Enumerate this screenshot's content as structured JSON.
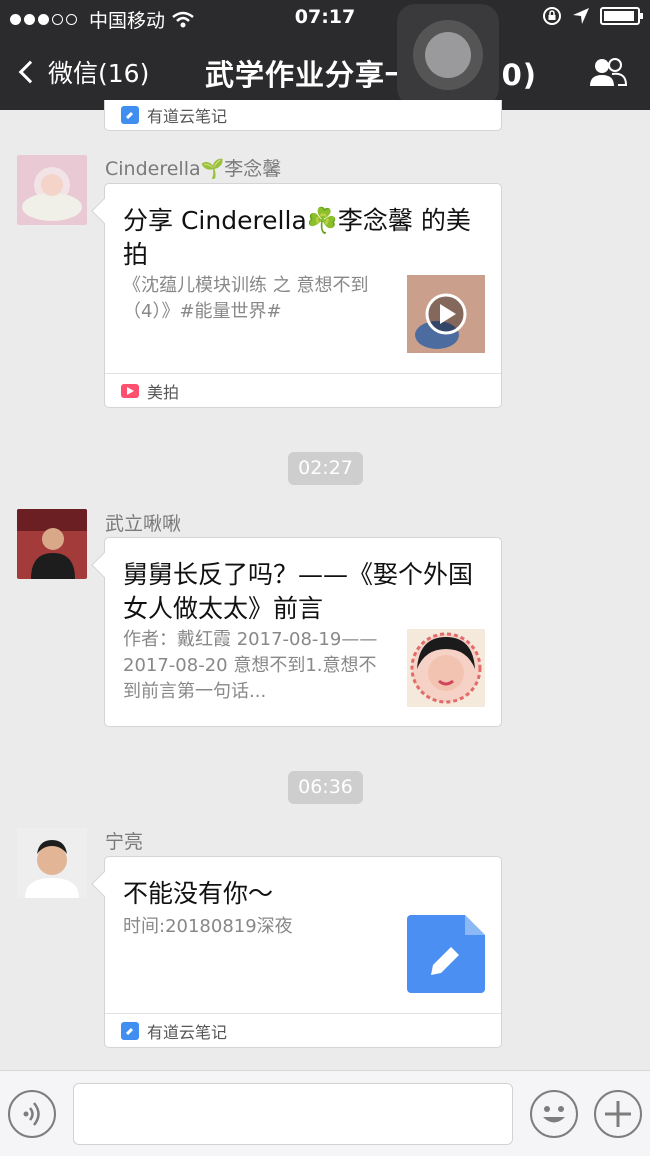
{
  "status_bar": {
    "carrier": "中国移动",
    "time": "07:17"
  },
  "nav": {
    "back_label": "微信(16)",
    "title": "武学作业分享一群(460)"
  },
  "messages": [
    {
      "source": "有道云笔记"
    },
    {
      "sender": "Cinderella🌱李念馨",
      "title": "分享 Cinderella☘️李念馨 的美拍",
      "desc": "《沈蕴儿模块训练 之 意想不到（4）》#能量世界#",
      "source": "美拍"
    },
    {
      "time": "02:27"
    },
    {
      "sender": "武立啾啾",
      "title": "舅舅长反了吗？——《娶个外国女人做太太》前言",
      "desc": "作者：戴红霞 2017-08-19——2017-08-20 意想不到1.意想不到前言第一句话...",
      "source": ""
    },
    {
      "time": "06:36"
    },
    {
      "sender": "宁亮",
      "title": "不能没有你～",
      "desc": "时间:20180819深夜",
      "source": "有道云笔记"
    }
  ],
  "colors": {
    "topbar": "#2b2b2d",
    "background": "#ebebeb",
    "ynote_blue": "#3f8ef0"
  }
}
